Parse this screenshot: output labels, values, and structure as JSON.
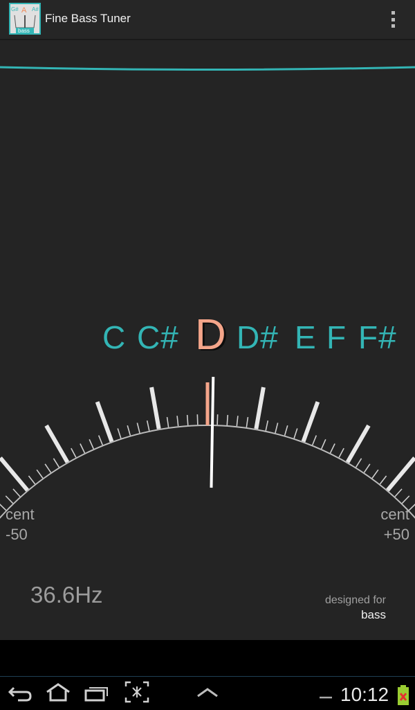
{
  "app": {
    "title": "Fine Bass Tuner",
    "icon_name": "tuner-app-icon",
    "icon_text": {
      "left": "G#",
      "center": "A",
      "right": "A#",
      "bottom": "bass"
    }
  },
  "menu": {
    "icon": "overflow-menu-icon"
  },
  "tuner": {
    "notes": [
      "C",
      "C#",
      "D",
      "D#",
      "E",
      "F",
      "F#"
    ],
    "active_note": "D",
    "needle_cents": 1,
    "frequency": "36.6Hz",
    "min_label": {
      "unit": "cent",
      "value": "-50"
    },
    "max_label": {
      "unit": "cent",
      "value": "+50"
    },
    "tagline": {
      "line1": "designed for",
      "line2": "bass"
    }
  },
  "system_bar": {
    "time": "10:12",
    "icons": [
      "back-icon",
      "home-icon",
      "recent-apps-icon",
      "screenshot-icon",
      "up-chevron-icon",
      "battery-charging-icon"
    ]
  },
  "colors": {
    "accent": "#33b5b5",
    "active_note": "#f4a58a",
    "background": "#242424",
    "needle": "#ffffff"
  }
}
